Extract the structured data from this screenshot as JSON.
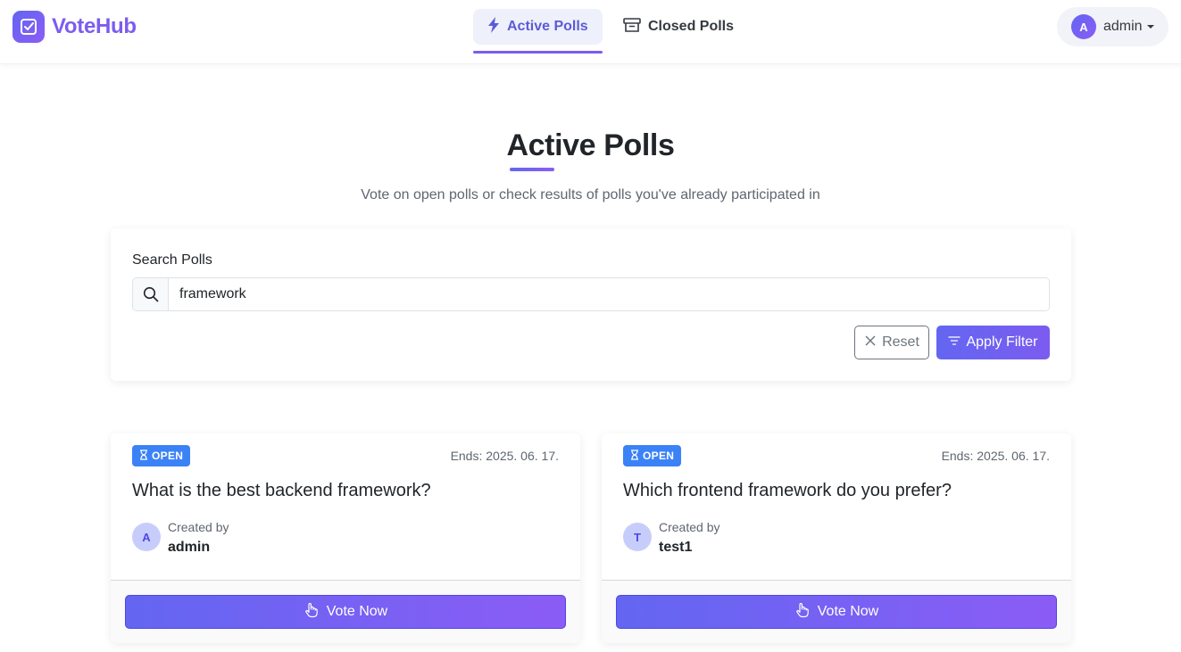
{
  "brand": {
    "name": "VoteHub"
  },
  "nav": {
    "active_tab": "Active Polls",
    "closed_tab": "Closed Polls"
  },
  "user": {
    "avatar_initial": "A",
    "name": "admin"
  },
  "header": {
    "title": "Active Polls",
    "subtitle": "Vote on open polls or check results of polls you've already participated in"
  },
  "filter": {
    "label": "Search Polls",
    "search_value": "framework",
    "reset_label": "Reset",
    "apply_label": "Apply Filter"
  },
  "polls": [
    {
      "status": "OPEN",
      "ends": "Ends: 2025. 06. 17.",
      "question": "What is the best backend framework?",
      "created_by_label": "Created by",
      "creator_initial": "A",
      "creator": "admin",
      "vote_label": "Vote Now"
    },
    {
      "status": "OPEN",
      "ends": "Ends: 2025. 06. 17.",
      "question": "Which frontend framework do you prefer?",
      "created_by_label": "Created by",
      "creator_initial": "T",
      "creator": "test1",
      "vote_label": "Vote Now"
    }
  ],
  "colors": {
    "accent": "#7c5cf0",
    "primary_gradient_start": "#6366f1",
    "primary_gradient_end": "#8b5cf6",
    "badge_open": "#3b82f6"
  }
}
